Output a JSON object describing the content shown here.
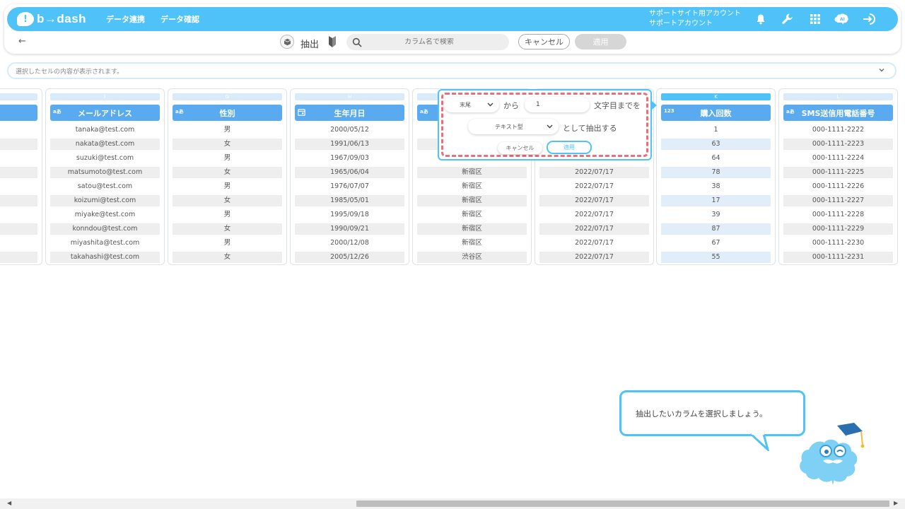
{
  "header": {
    "logo_mark": "!",
    "logo_text": "b→dash",
    "nav": [
      "データ連携",
      "データ確認"
    ],
    "account_line1": "サポートサイト用アカウント",
    "account_line2": "サポートアカウント",
    "icons": [
      "bell-icon",
      "wrench-icon",
      "grid-icon",
      "brain-icon",
      "logout-icon"
    ]
  },
  "toolbar": {
    "back": "←",
    "title": "抽出",
    "search_placeholder": "カラム名で検索",
    "cancel_label": "キャンセル",
    "apply_label": "適用"
  },
  "cell_bar": {
    "placeholder": "選択したセルの内容が表示されます。"
  },
  "columns": [
    {
      "letter": "",
      "header": "",
      "type_icon": "",
      "cells": [
        "",
        "",
        "",
        "",
        "",
        "",
        "",
        "",
        "",
        ""
      ]
    },
    {
      "letter": "F",
      "header": "メールアドレス",
      "type_icon": "aあ",
      "cells": [
        "tanaka@test.com",
        "nakata@test.com",
        "suzuki@test.com",
        "matsumoto@test.com",
        "satou@test.com",
        "koizumi@test.com",
        "miyake@test.com",
        "konndou@test.com",
        "miyashita@test.com",
        "takahashi@test.com"
      ]
    },
    {
      "letter": "G",
      "header": "性別",
      "type_icon": "aあ",
      "cells": [
        "男",
        "女",
        "男",
        "女",
        "男",
        "女",
        "男",
        "女",
        "男",
        "女"
      ]
    },
    {
      "letter": "H",
      "header": "生年月日",
      "type_icon": "cal",
      "cells": [
        "2000/05/12",
        "1991/06/13",
        "1967/09/03",
        "1965/06/04",
        "1976/07/07",
        "1985/05/01",
        "1995/09/18",
        "1990/09/21",
        "2000/12/08",
        "2005/12/26"
      ]
    },
    {
      "letter": "",
      "header": "",
      "type_icon": "aあ",
      "cells": [
        "",
        "",
        "",
        "新宿区",
        "新宿区",
        "新宿区",
        "新宿区",
        "新宿区",
        "新宿区",
        "渋谷区"
      ]
    },
    {
      "letter": "",
      "header": "",
      "type_icon": "",
      "cells": [
        "",
        "",
        "",
        "2022/07/17",
        "2022/07/17",
        "2022/07/17",
        "2022/07/17",
        "2022/07/17",
        "2022/07/17",
        "2022/07/17"
      ]
    },
    {
      "letter": "K",
      "header": "購入回数",
      "type_icon": "123",
      "cells": [
        "1",
        "63",
        "64",
        "78",
        "38",
        "17",
        "39",
        "87",
        "67",
        "55"
      ]
    },
    {
      "letter": "L",
      "header": "SMS送信用電話番号",
      "type_icon": "aあ",
      "cells": [
        "000-1111-2222",
        "000-1111-2223",
        "000-1111-2224",
        "000-1111-2225",
        "000-1111-2226",
        "000-1111-2227",
        "000-1111-2228",
        "000-1111-2229",
        "000-1111-2230",
        "000-1111-2231"
      ]
    }
  ],
  "popup": {
    "position_select": "末尾",
    "from_label": "から",
    "count_value": "1",
    "until_label": "文字目までを",
    "type_select": "テキスト型",
    "as_label": "として抽出する",
    "cancel_label": "キャンセル",
    "apply_label": "適用"
  },
  "tip": {
    "message": "抽出したいカラムを選択しましょう。"
  },
  "colors": {
    "brand": "#4fc3f7",
    "header_blue": "#5aaaf0",
    "highlight_dash": "#e7707b"
  }
}
